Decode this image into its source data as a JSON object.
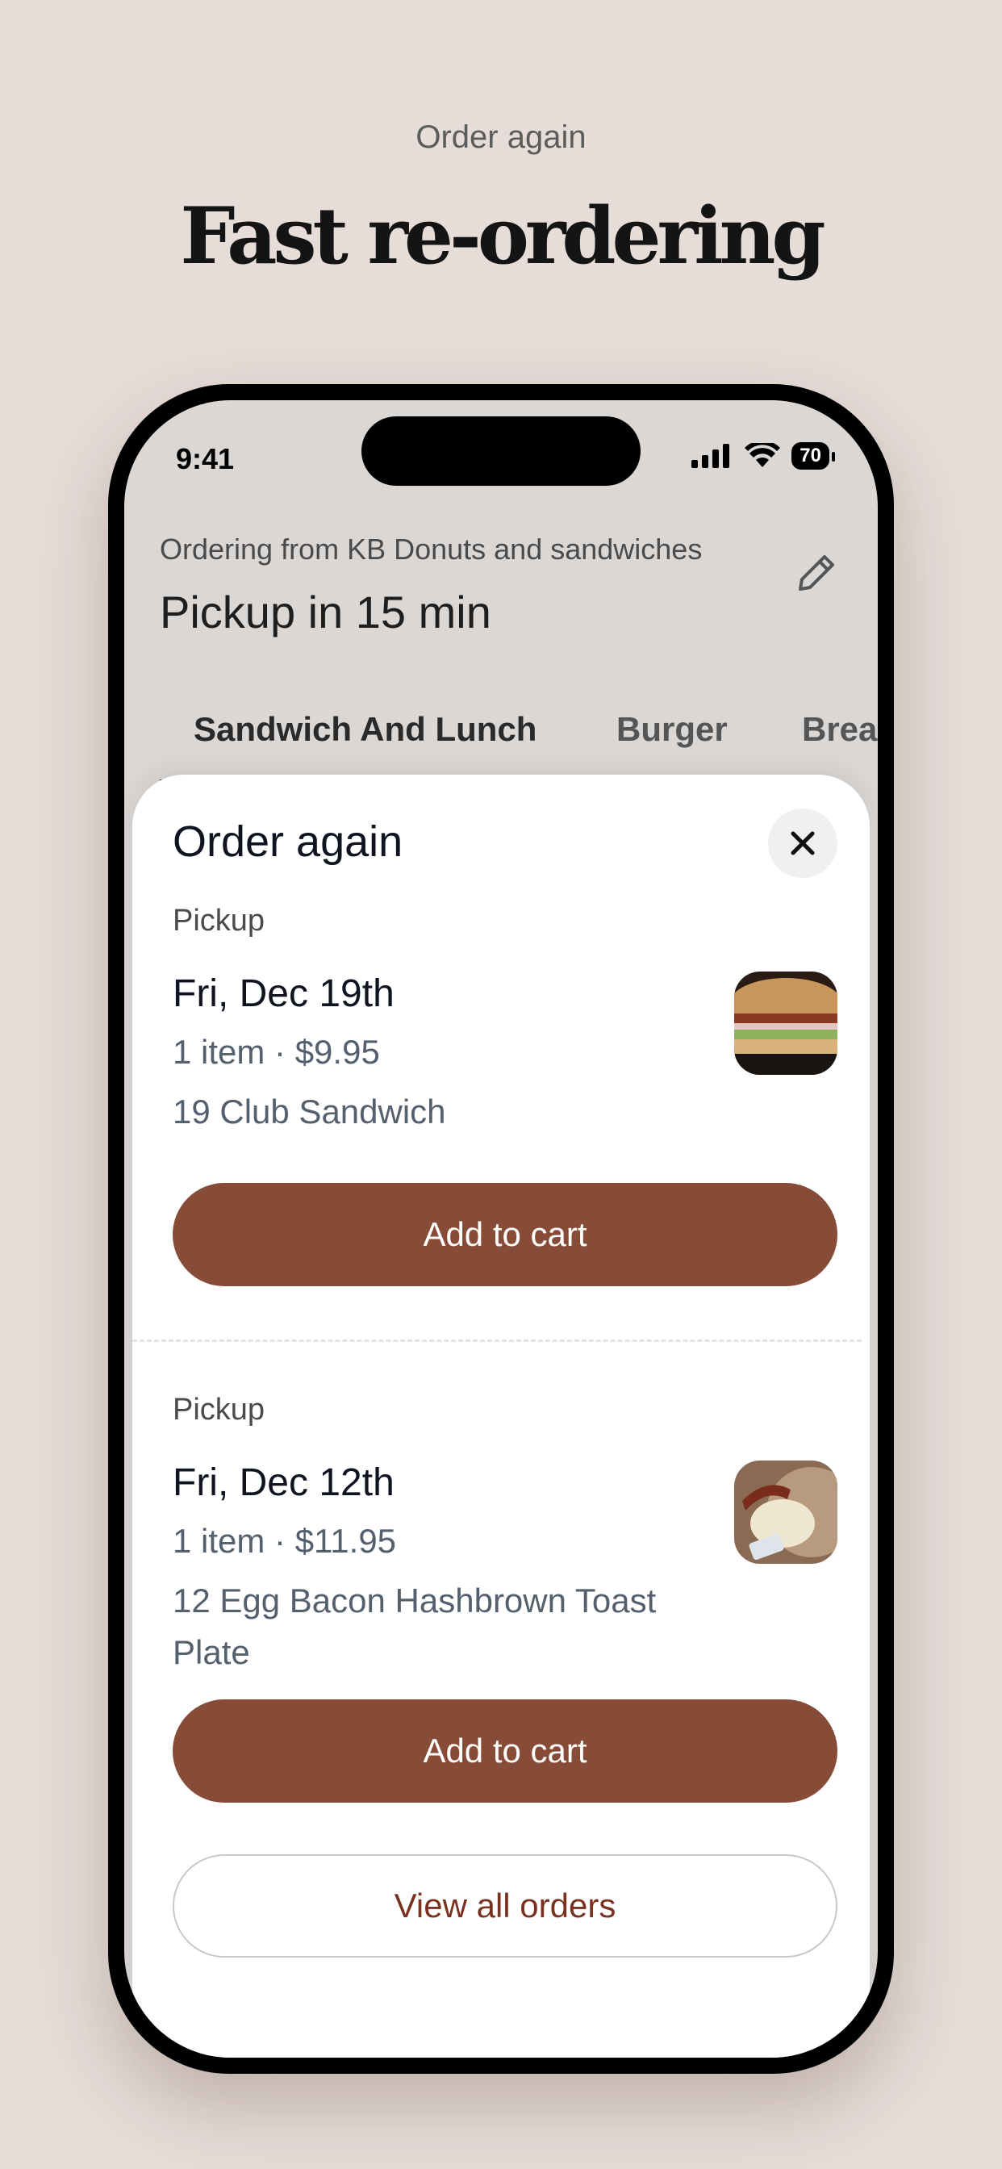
{
  "promo": {
    "eyebrow": "Order again",
    "title": "Fast re-ordering"
  },
  "status_bar": {
    "time": "9:41",
    "battery": "70"
  },
  "header": {
    "subtitle": "Ordering from KB Donuts and sandwiches",
    "title": "Pickup in 15 min"
  },
  "categories": [
    "Sandwich And Lunch",
    "Burger",
    "Brea"
  ],
  "sheet": {
    "title": "Order again",
    "orders": [
      {
        "type": "Pickup",
        "date": "Fri, Dec 19th",
        "meta": "1 item · $9.95",
        "name": "19 Club Sandwich",
        "button": "Add to cart"
      },
      {
        "type": "Pickup",
        "date": "Fri, Dec 12th",
        "meta": "1 item · $11.95",
        "name": "12 Egg Bacon Hashbrown Toast Plate",
        "button": "Add to cart"
      }
    ],
    "view_all": "View all orders"
  },
  "colors": {
    "background": "#e6dcd8",
    "accent": "#864c37",
    "link": "#7a3220"
  }
}
